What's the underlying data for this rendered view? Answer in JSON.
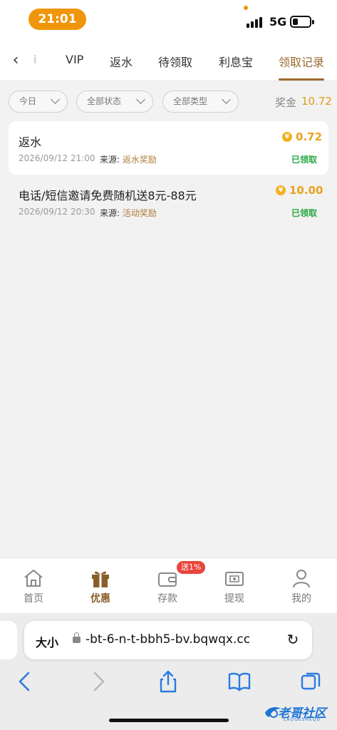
{
  "status_bar": {
    "time": "21:01",
    "network": "5G"
  },
  "tabs": {
    "back_icon": "chevron-left-icon",
    "items": [
      {
        "label": "i",
        "state": "partial"
      },
      {
        "label": "VIP"
      },
      {
        "label": "返水"
      },
      {
        "label": "待领取"
      },
      {
        "label": "利息宝"
      },
      {
        "label": "领取记录",
        "state": "active"
      }
    ]
  },
  "filters": {
    "date": "今日",
    "status": "全部状态",
    "type": "全部类型",
    "bonus_label": "奖金",
    "bonus_value": "10.72"
  },
  "records": [
    {
      "title": "返水",
      "date": "2026/09/12 21:00",
      "source_label": "来源:",
      "source": "返水奖励",
      "coin": "¥",
      "amount": "0.72",
      "status": "已领取"
    },
    {
      "title": "电话/短信邀请免费随机送8元-88元",
      "date": "2026/09/12 20:30",
      "source_label": "来源:",
      "source": "活动奖励",
      "coin": "¥",
      "amount": "10.00",
      "status": "已领取"
    }
  ],
  "bottom_nav": [
    {
      "label": "首页",
      "icon": "home-icon"
    },
    {
      "label": "优惠",
      "icon": "gift-icon",
      "active": true
    },
    {
      "label": "存款",
      "icon": "wallet-icon",
      "badge": "送1%"
    },
    {
      "label": "提现",
      "icon": "withdraw-icon"
    },
    {
      "label": "我的",
      "icon": "user-icon"
    }
  ],
  "browser": {
    "text_size": "大小",
    "url": "-bt-6-n-t-bbh5-bv.bqwqx.cc",
    "reload_icon": "reload-icon"
  },
  "watermark": {
    "text": "老哥社区",
    "sub": "LAOGESHEQU"
  },
  "colors": {
    "accent": "#9b6a2f",
    "gold": "#e9a21c",
    "green": "#27a845",
    "pill": "#f0960a"
  }
}
